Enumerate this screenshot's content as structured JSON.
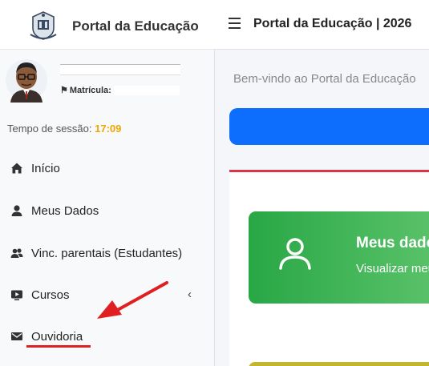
{
  "brand": {
    "title": "Portal da Educação"
  },
  "user": {
    "matricula_label": "Matrícula:"
  },
  "session": {
    "label": "Tempo de sessão:",
    "time": "17:09"
  },
  "nav": {
    "items": [
      {
        "label": "Início",
        "icon": "home-icon"
      },
      {
        "label": "Meus Dados",
        "icon": "user-icon"
      },
      {
        "label": "Vinc. parentais (Estudantes)",
        "icon": "users-icon"
      },
      {
        "label": "Cursos",
        "icon": "video-icon"
      },
      {
        "label": "Ouvidoria",
        "icon": "envelope-icon"
      }
    ]
  },
  "header": {
    "title": "Portal da Educação | 2026"
  },
  "main": {
    "welcome": "Bem-vindo ao Portal da Educação",
    "card": {
      "title": "Meus dados",
      "subtitle": "Visualizar meus"
    }
  },
  "colors": {
    "accent_blue": "#0d6efd",
    "success_green": "#28a745",
    "session_time": "#f0a500",
    "annotation_red": "#e02020"
  }
}
